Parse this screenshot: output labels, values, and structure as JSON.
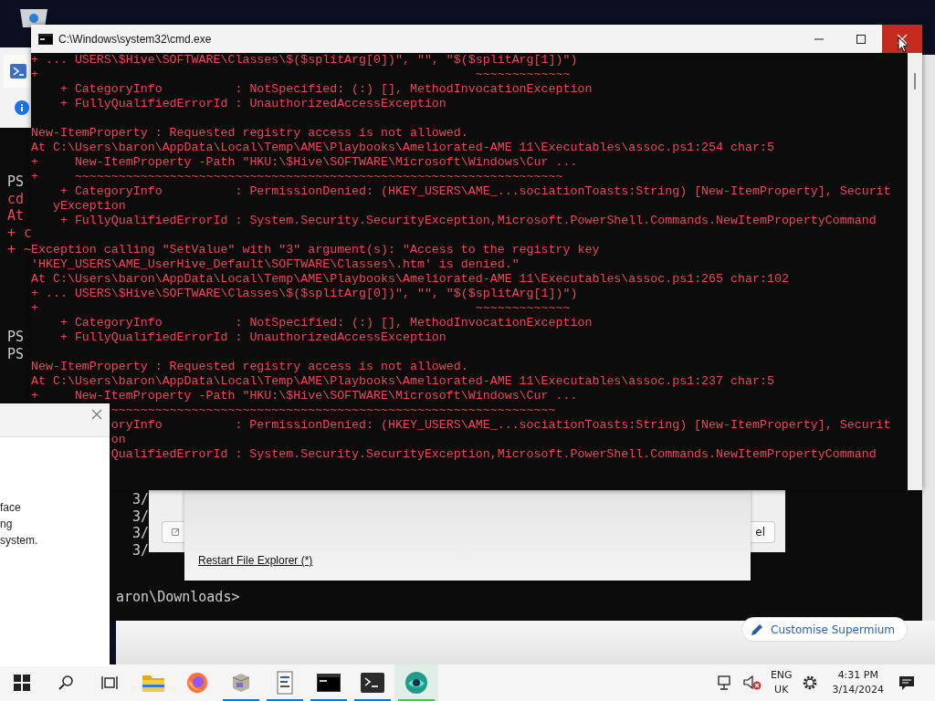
{
  "background_terminal": {
    "top_fragments": [
      {
        "text": "PS",
        "kind": "prompt"
      },
      {
        "text": "cd",
        "kind": "error"
      },
      {
        "text": "At",
        "kind": "error"
      },
      {
        "text": "+ c",
        "kind": "error"
      },
      {
        "text": "+ ~",
        "kind": "error"
      }
    ],
    "lower_fragments": [
      {
        "text": "PS",
        "kind": "prompt"
      },
      {
        "text": "PS",
        "kind": "prompt"
      }
    ],
    "date_fragments": [
      "3/",
      "3/",
      "3/",
      "3/"
    ],
    "prompt": "aron\\Downloads>"
  },
  "left_dialog": {
    "lines": [
      "face",
      "ng",
      "system."
    ]
  },
  "browser": {
    "customise_button": "Customise Supermium"
  },
  "middle_dialog": {
    "button_fragment": "el"
  },
  "front_dialog": {
    "link": "Restart File Explorer (*)"
  },
  "cmd_window": {
    "title": "C:\\Windows\\system32\\cmd.exe",
    "blocks": [
      {
        "lines": [
          "+ ... USERS\\$Hive\\SOFTWARE\\Classes\\$($splitArg[0])\", \"\", \"$($splitArg[1])\")",
          "+                                                            ~~~~~~~~~~~~~",
          "    + CategoryInfo          : NotSpecified: (:) [], MethodInvocationException",
          "    + FullyQualifiedErrorId : UnauthorizedAccessException"
        ]
      },
      {
        "lines": [
          "New-ItemProperty : Requested registry access is not allowed.",
          "At C:\\Users\\baron\\AppData\\Local\\Temp\\AME\\Playbooks\\Ameliorated-AME 11\\Executables\\assoc.ps1:254 char:5",
          "+     New-ItemProperty -Path \"HKU:\\$Hive\\SOFTWARE\\Microsoft\\Windows\\Cur ...",
          "+     ~~~~~~~~~~~~~~~~~~~~~~~~~~~~~~~~~~~~~~~~~~~~~~~~~~~~~~~~~~~~~~~~~~~",
          "    + CategoryInfo          : PermissionDenied: (HKEY_USERS\\AME_...sociationToasts:String) [New-ItemProperty], Securit",
          "   yException",
          "    + FullyQualifiedErrorId : System.Security.SecurityException,Microsoft.PowerShell.Commands.NewItemPropertyCommand"
        ]
      },
      {
        "lines": [
          "Exception calling \"SetValue\" with \"3\" argument(s): \"Access to the registry key",
          "'HKEY_USERS\\AME_UserHive_Default\\SOFTWARE\\Classes\\.htm' is denied.\"",
          "At C:\\Users\\baron\\AppData\\Local\\Temp\\AME\\Playbooks\\Ameliorated-AME 11\\Executables\\assoc.ps1:265 char:102",
          "+ ... USERS\\$Hive\\SOFTWARE\\Classes\\$($splitArg[0])\", \"\", \"$($splitArg[1])\")",
          "+                                                            ~~~~~~~~~~~~~",
          "    + CategoryInfo          : NotSpecified: (:) [], MethodInvocationException",
          "    + FullyQualifiedErrorId : UnauthorizedAccessException"
        ]
      },
      {
        "lines": [
          "New-ItemProperty : Requested registry access is not allowed.",
          "At C:\\Users\\baron\\AppData\\Local\\Temp\\AME\\Playbooks\\Ameliorated-AME 11\\Executables\\assoc.ps1:237 char:5",
          "+     New-ItemProperty -Path \"HKU:\\$Hive\\SOFTWARE\\Microsoft\\Windows\\Cur ..."
        ],
        "covered_lines": [
          "~~~~~~~~~~~~~~~~~~~~~~~~~~~~~~~~~~~~~~~~~~~~~~~~~~~~~~~~~~~~~",
          "oryInfo          : PermissionDenied: (HKEY_USERS\\AME_...sociationToasts:String) [New-ItemProperty], Securit",
          "on",
          "QualifiedErrorId : System.Security.SecurityException,Microsoft.PowerShell.Commands.NewItemPropertyCommand"
        ]
      }
    ]
  },
  "taskbar": {
    "apps": [
      {
        "kind": "folder",
        "running": false,
        "active": false
      },
      {
        "kind": "firefox",
        "running": false,
        "active": false
      },
      {
        "kind": "box",
        "running": true,
        "active": false
      },
      {
        "kind": "document",
        "running": true,
        "active": false
      },
      {
        "kind": "cmd",
        "running": true,
        "active": false
      },
      {
        "kind": "terminal",
        "running": true,
        "active": false
      },
      {
        "kind": "globe",
        "running": true,
        "active": true
      }
    ],
    "language": [
      "ENG",
      "UK"
    ],
    "time": "4:31 PM",
    "date": "3/14/2024"
  }
}
